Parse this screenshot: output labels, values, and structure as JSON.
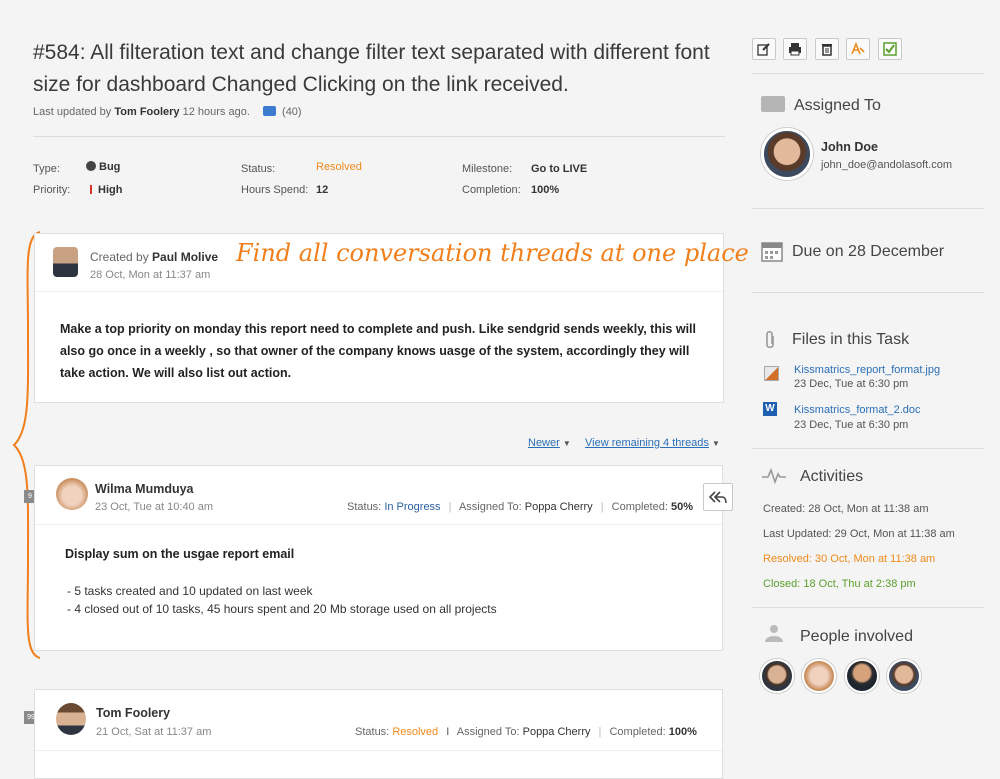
{
  "task": {
    "title": "#584: All filteration text and change filter text separated with different font size for dashboard Changed Clicking on the link received.",
    "last_updated_prefix": "Last updated by",
    "last_updated_user": "Tom Foolery",
    "last_updated_time": "12 hours ago.",
    "comment_count": "(40)"
  },
  "properties": {
    "type_label": "Type:",
    "type_value": "Bug",
    "priority_label": "Priority:",
    "priority_value": "High",
    "status_label": "Status:",
    "status_value": "Resolved",
    "hours_label": "Hours Spend:",
    "hours_value": "12",
    "milestone_label": "Milestone:",
    "milestone_value": "Go to LIVE",
    "completion_label": "Completion:",
    "completion_value": "100%"
  },
  "callout": "Find all conversation threads at one place",
  "first_post": {
    "created_by_label": "Created by",
    "author": "Paul Molive",
    "date": "28 Oct, Mon at 11:37 am",
    "body": "Make a top priority on monday this report need to complete and push. Like sendgrid sends weekly, this will also go once in a weekly , so that owner of the company knows uasge of the system, accordingly they will take action. We will also list out action."
  },
  "thread_controls": {
    "newer": "Newer",
    "view_remaining": "View remaining 4 threads"
  },
  "threads": [
    {
      "badge": "9",
      "author": "Wilma Mumduya",
      "date": "23 Oct, Tue at 10:40 am",
      "status_label": "Status:",
      "status_value": "In Progress",
      "assigned_label": "Assigned To:",
      "assigned_value": "Poppa Cherry",
      "completed_label": "Completed:",
      "completed_value": "50%",
      "heading": "Display sum on the usgae report email",
      "items": [
        "- 5 tasks created and 10 updated on last week",
        "- 4 closed out of 10 tasks, 45 hours spent and 20 Mb storage used on all projects"
      ]
    },
    {
      "badge": "99",
      "author": "Tom Foolery",
      "date": "21 Oct, Sat at 11:37 am",
      "status_label": "Status:",
      "status_value": "Resolved",
      "assigned_label": "Assigned To:",
      "assigned_value": "Poppa Cherry",
      "completed_label": "Completed:",
      "completed_value": "100%"
    }
  ],
  "sidebar": {
    "assigned_heading": "Assigned To",
    "assignee_name": "John Doe",
    "assignee_email": "john_doe@andolasoft.com",
    "due": "Due on 28 December",
    "files_heading": "Files in this Task",
    "files": [
      {
        "name": "Kissmatrics_report_format.jpg",
        "date": "23 Dec, Tue at 6:30 pm"
      },
      {
        "name": "Kissmatrics_format_2.doc",
        "date": "23 Dec, Tue at 6:30 pm"
      }
    ],
    "activities_heading": "Activities",
    "activities": {
      "created": "Created: 28 Oct, Mon at 11:38 am",
      "updated": "Last Updated: 29 Oct, Mon at 11:38 am",
      "resolved": "Resolved: 30 Oct, Mon at 11:38 am",
      "closed": "Closed: 18 Oct, Thu at 2:38 pm"
    },
    "people_heading": "People involved"
  },
  "colors": {
    "resolved": "#f08a1c",
    "in_progress": "#2a5f9e",
    "closed": "#5aa02c",
    "callout": "#f07f1c",
    "link": "#2a6fb5"
  }
}
